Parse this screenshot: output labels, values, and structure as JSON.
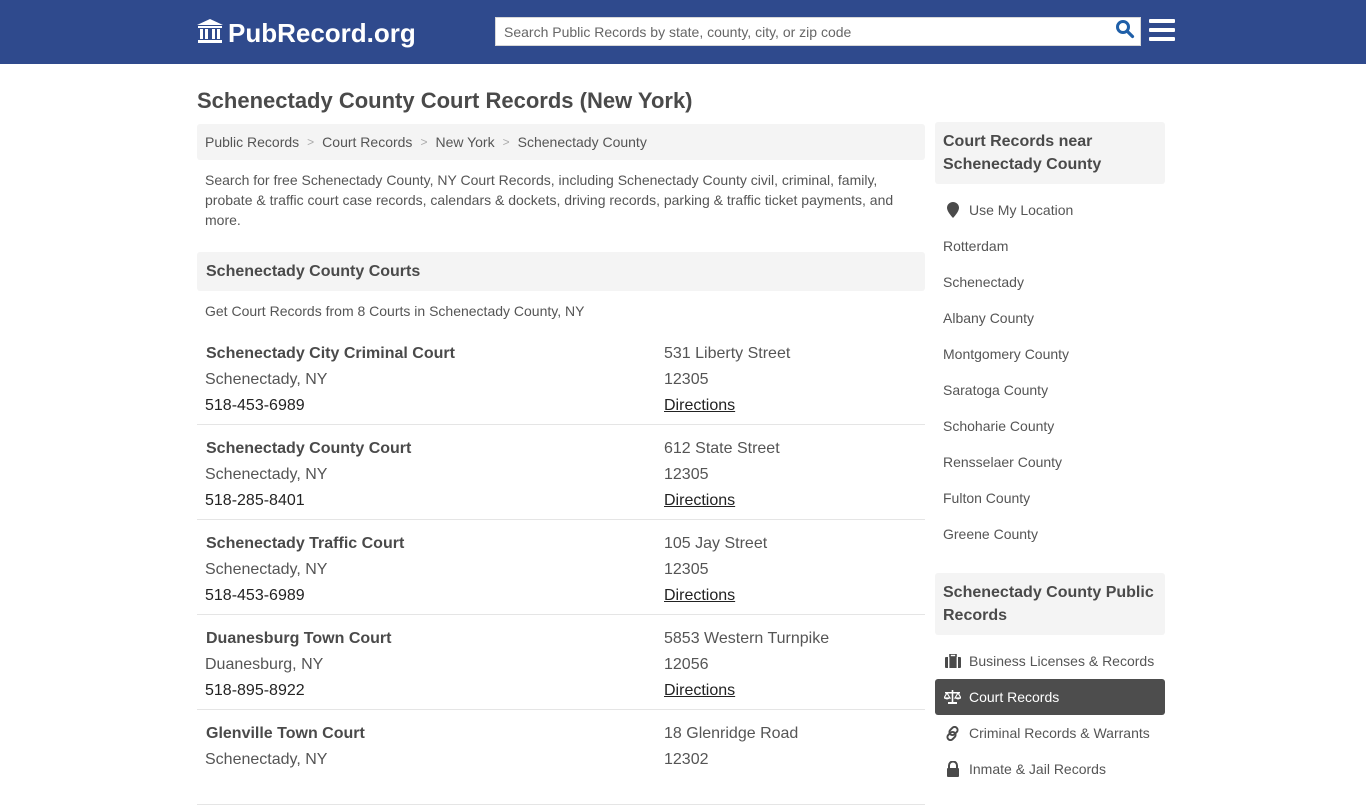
{
  "header": {
    "logo_text": "PubRecord.org",
    "search_placeholder": "Search Public Records by state, county, city, or zip code",
    "brand_color": "#2f4a8d"
  },
  "page": {
    "title": "Schenectady County Court Records (New York)"
  },
  "breadcrumb": [
    {
      "label": "Public Records"
    },
    {
      "label": "Court Records"
    },
    {
      "label": "New York"
    },
    {
      "label": "Schenectady County"
    }
  ],
  "intro": "Search for free Schenectady County, NY Court Records, including Schenectady County civil, criminal, family, probate & traffic court case records, calendars & dockets, driving records, parking & traffic ticket payments, and more.",
  "courts_section": {
    "heading": "Schenectady County Courts",
    "subheading": "Get Court Records from 8 Courts in Schenectady County, NY",
    "directions_label": "Directions",
    "courts": [
      {
        "name": "Schenectady City Criminal Court",
        "city": "Schenectady, NY",
        "phone": "518-453-6989",
        "street": "531 Liberty Street",
        "zip": "12305",
        "directions": "Directions"
      },
      {
        "name": "Schenectady County Court",
        "city": "Schenectady, NY",
        "phone": "518-285-8401",
        "street": "612 State Street",
        "zip": "12305",
        "directions": "Directions"
      },
      {
        "name": "Schenectady Traffic Court",
        "city": "Schenectady, NY",
        "phone": "518-453-6989",
        "street": "105 Jay Street",
        "zip": "12305",
        "directions": "Directions"
      },
      {
        "name": "Duanesburg Town Court",
        "city": "Duanesburg, NY",
        "phone": "518-895-8922",
        "street": "5853 Western Turnpike",
        "zip": "12056",
        "directions": "Directions"
      },
      {
        "name": "Glenville Town Court",
        "city": "Schenectady, NY",
        "phone": "",
        "street": "18 Glenridge Road",
        "zip": "12302",
        "directions": ""
      }
    ]
  },
  "sidebar": {
    "nearby_heading": "Court Records near Schenectady County",
    "use_location": "Use My Location",
    "nearby": [
      {
        "label": "Rotterdam"
      },
      {
        "label": "Schenectady"
      },
      {
        "label": "Albany County"
      },
      {
        "label": "Montgomery County"
      },
      {
        "label": "Saratoga County"
      },
      {
        "label": "Schoharie County"
      },
      {
        "label": "Rensselaer County"
      },
      {
        "label": "Fulton County"
      },
      {
        "label": "Greene County"
      }
    ],
    "public_heading": "Schenectady County Public Records",
    "public_records": [
      {
        "label": "Business Licenses & Records",
        "icon": "briefcase-icon",
        "active": false
      },
      {
        "label": "Court Records",
        "icon": "scale-icon",
        "active": true
      },
      {
        "label": "Criminal Records & Warrants",
        "icon": "link-icon",
        "active": false
      },
      {
        "label": "Inmate & Jail Records",
        "icon": "lock-icon",
        "active": false
      }
    ]
  }
}
